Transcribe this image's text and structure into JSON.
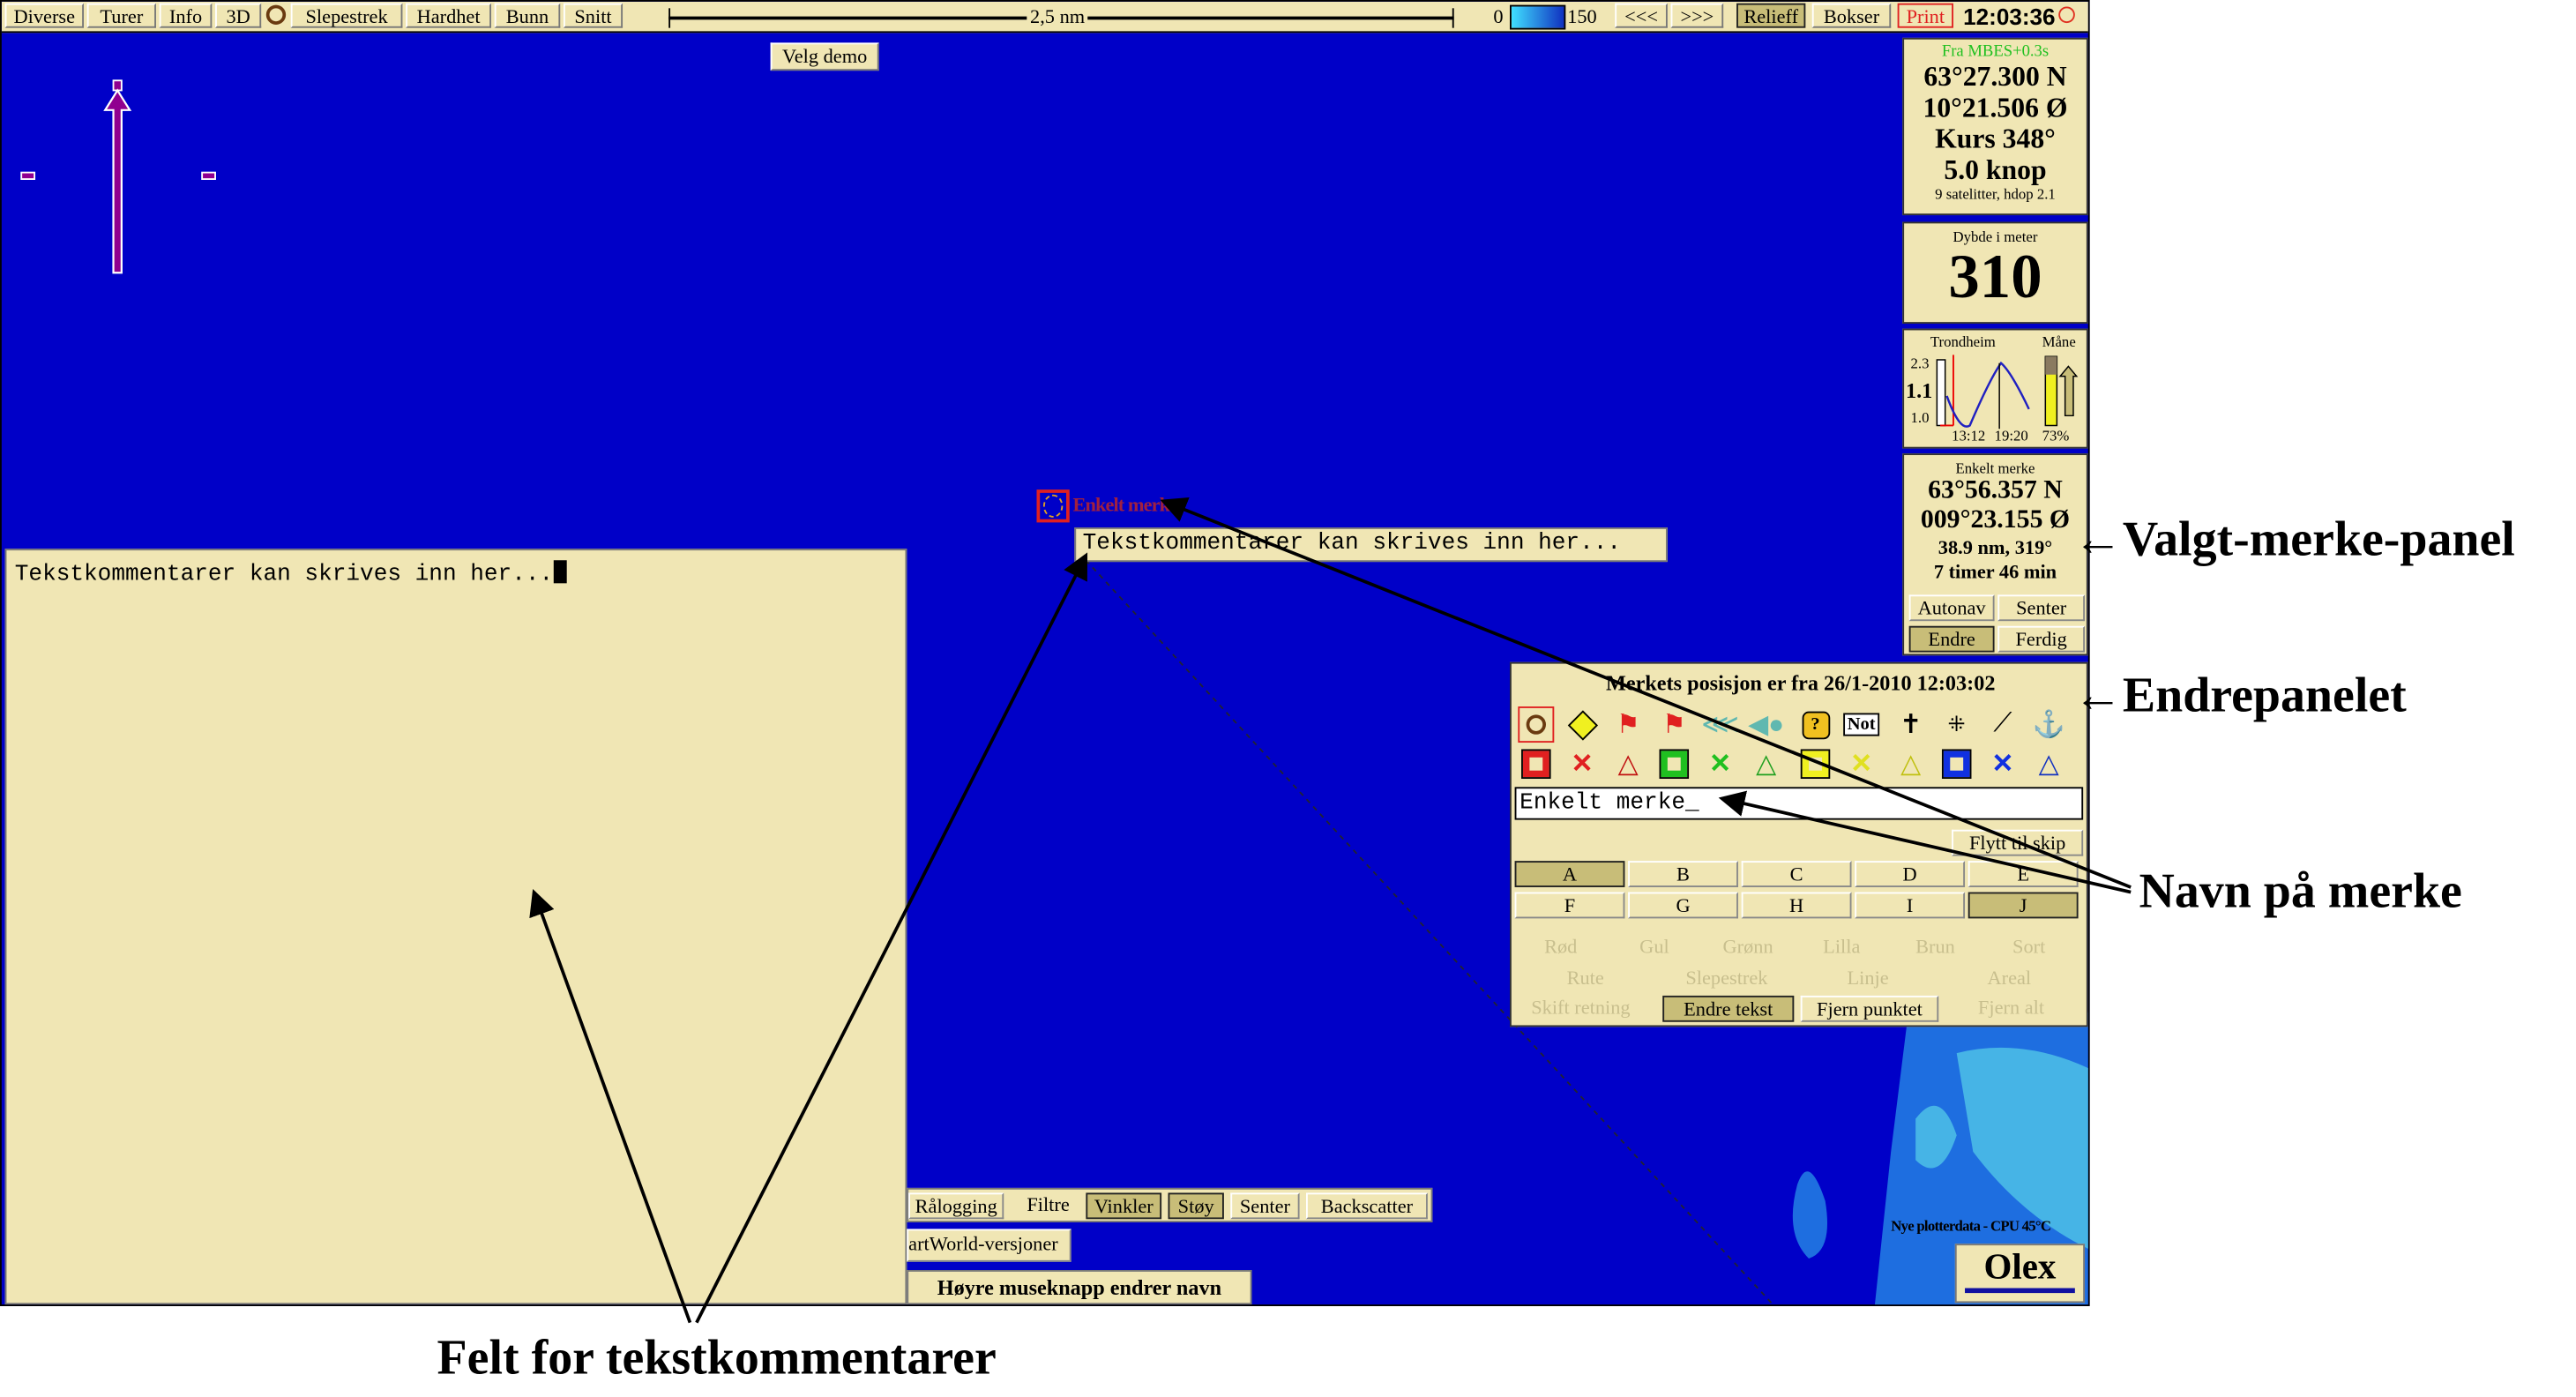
{
  "toolbar": {
    "items": [
      "Diverse",
      "Turer",
      "Info",
      "3D",
      "Slepestrek",
      "Hardhet",
      "Bunn",
      "Snitt"
    ],
    "scale_label": "2,5 nm",
    "depth_min": "0",
    "depth_max": "150",
    "prev": "<<<",
    "next": ">>>",
    "relieff": "Relieff",
    "bokser": "Bokser",
    "print": "Print",
    "clock": "12:03:36"
  },
  "demo_button": "Velg demo",
  "position_panel": {
    "source": "Fra MBES+0.3s",
    "lat": "63°27.300 N",
    "lon": "10°21.506 Ø",
    "course": "Kurs 348°",
    "speed": "5.0 knop",
    "sats": "9 satelitter, hdop 2.1"
  },
  "depth_panel": {
    "label": "Dybde i meter",
    "value": "310"
  },
  "tide_panel": {
    "place": "Trondheim",
    "moon": "Måne",
    "high": "2.3",
    "current": "1.1",
    "low": "1.0",
    "t1": "13:12",
    "t2": "19:20",
    "moon_pct": "73%",
    "moon_fraction": 0.73
  },
  "mark_panel": {
    "title": "Enkelt merke",
    "lat": "63°56.357 N",
    "lon": "009°23.155 Ø",
    "dist": "38.9 nm, 319°",
    "eta": "7 timer 46 min",
    "buttons": [
      "Autonav",
      "Senter",
      "Endre",
      "Ferdig"
    ]
  },
  "edit_panel": {
    "title": "Merkets posisjon er fra 26/1-2010 12:03:02",
    "symbols_row1": [
      "circle-mark-icon",
      "warning-icon",
      "flag-icon",
      "double-flag-icon",
      "fish-school-icon",
      "fish-icon",
      "question-icon",
      "net-icon",
      "wreck-icon",
      "dots-icon",
      "trawl-icon",
      "anchor-icon"
    ],
    "not_label": "Not",
    "name_value": "Enkelt merke_",
    "move_to_ship": "Flytt til skip",
    "letters": [
      "A",
      "B",
      "C",
      "D",
      "E",
      "F",
      "G",
      "H",
      "I",
      "J"
    ],
    "colors": [
      "Rød",
      "Gul",
      "Grønn",
      "Lilla",
      "Brun",
      "Sort"
    ],
    "types": [
      "Rute",
      "Slepestrek",
      "Linje",
      "Areal"
    ],
    "actions": [
      "Skift retning",
      "Endre tekst",
      "Fjern punktet",
      "Fjern alt"
    ]
  },
  "map": {
    "mark_label": "Enkelt merke",
    "tooltip": "Tekstkommentarer kan skrives inn her...",
    "water_color": "#0000c8",
    "shallow_color": "#1e6ee0",
    "shallower_color": "#46b4e6"
  },
  "comment_field": {
    "value": "Tekstkommentarer kan skrives inn her..."
  },
  "bottom": {
    "row1": [
      "Rålogging",
      "Filtre",
      "Vinkler",
      "Støy",
      "Senter",
      "Backscatter"
    ],
    "versions": "artWorld-versjoner",
    "hint": "Høyre museknapp endrer navn",
    "status": "Nye plotterdata - CPU 45°C",
    "logo": "Olex"
  },
  "annotations": {
    "mark_panel": "←Valgt-merke-panel",
    "edit_panel": "←Endrepanelet",
    "name": "Navn på merke",
    "comments": "Felt for tekstkommentarer"
  }
}
